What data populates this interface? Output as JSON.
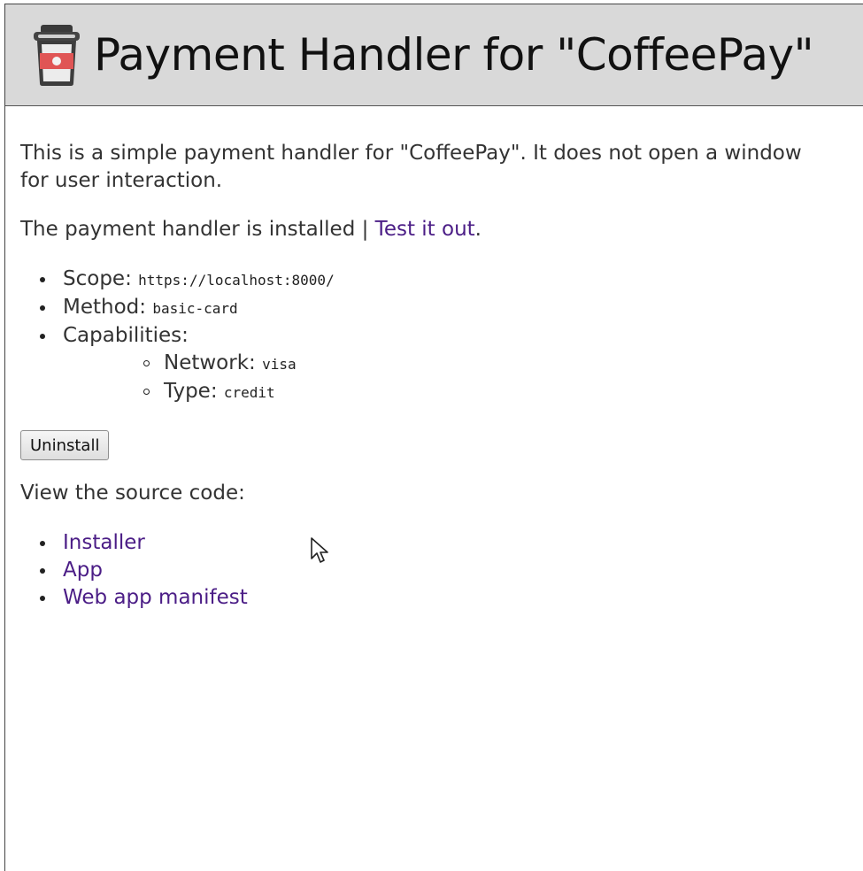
{
  "header": {
    "title": "Payment Handler for \"CoffeePay\"",
    "logo_icon": "coffee-cup-icon"
  },
  "intro": {
    "text": "This is a simple payment handler for \"CoffeePay\". It does not open a window for user interaction."
  },
  "status": {
    "text": "The payment handler is installed | ",
    "link_label": "Test it out",
    "suffix": "."
  },
  "details": {
    "scope_label": "Scope: ",
    "scope_value": "https://localhost:8000/",
    "method_label": "Method: ",
    "method_value": "basic-card",
    "capabilities_label": "Capabilities:",
    "network_label": "Network: ",
    "network_value": "visa",
    "type_label": "Type: ",
    "type_value": "credit"
  },
  "uninstall_label": "Uninstall",
  "source": {
    "label": "View the source code:",
    "links": [
      "Installer",
      "App",
      "Web app manifest"
    ]
  },
  "colors": {
    "link": "#4b1d86",
    "header_bg": "#d9d9d9",
    "logo_red": "#e05555"
  }
}
